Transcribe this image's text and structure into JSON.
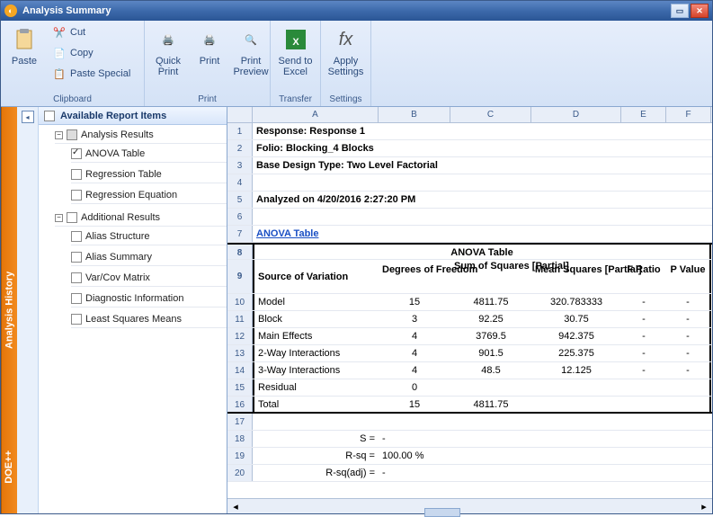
{
  "window": {
    "title": "Analysis Summary"
  },
  "ribbon": {
    "paste": "Paste",
    "cut": "Cut",
    "copy": "Copy",
    "paste_special": "Paste Special",
    "quick_print": "Quick\nPrint",
    "print": "Print",
    "print_preview": "Print\nPreview",
    "send_excel": "Send to\nExcel",
    "apply_settings": "Apply\nSettings",
    "grp_clipboard": "Clipboard",
    "grp_print": "Print",
    "grp_transfer": "Transfer",
    "grp_settings": "Settings"
  },
  "history_tab": "Analysis History",
  "branding": "DOE++",
  "tree": {
    "header": "Available Report Items",
    "root1": "Analysis Results",
    "items1": [
      "ANOVA Table",
      "Regression Table",
      "Regression Equation"
    ],
    "root2": "Additional Results",
    "items2": [
      "Alias Structure",
      "Alias Summary",
      "Var/Cov Matrix",
      "Diagnostic Information",
      "Least Squares Means"
    ]
  },
  "columns": [
    "A",
    "B",
    "C",
    "D",
    "E",
    "F"
  ],
  "meta": {
    "response": "Response: Response 1",
    "folio": "Folio: Blocking_4 Blocks",
    "design": "Base Design Type: Two Level Factorial",
    "analyzed": "Analyzed on 4/20/2016 2:27:20 PM",
    "anova_link": "ANOVA Table",
    "anova_title": "ANOVA Table"
  },
  "headers": {
    "source": "Source of Variation",
    "df": "Degrees of Freedom",
    "ss": "Sum of Squares [Partial]",
    "ms": "Mean Squares [Partial]",
    "f": "F Ratio",
    "p": "P Value"
  },
  "table": [
    {
      "src": "Model",
      "df": "15",
      "ss": "4811.75",
      "ms": "320.783333",
      "f": "-",
      "p": "-"
    },
    {
      "src": "Block",
      "df": "3",
      "ss": "92.25",
      "ms": "30.75",
      "f": "-",
      "p": "-"
    },
    {
      "src": "Main Effects",
      "df": "4",
      "ss": "3769.5",
      "ms": "942.375",
      "f": "-",
      "p": "-"
    },
    {
      "src": " 2-Way Interactions",
      "df": "4",
      "ss": "901.5",
      "ms": "225.375",
      "f": "-",
      "p": "-"
    },
    {
      "src": " 3-Way Interactions",
      "df": "4",
      "ss": "48.5",
      "ms": "12.125",
      "f": "-",
      "p": "-"
    },
    {
      "src": "Residual",
      "df": "0",
      "ss": "",
      "ms": "",
      "f": "",
      "p": ""
    },
    {
      "src": "Total",
      "df": "15",
      "ss": "4811.75",
      "ms": "",
      "f": "",
      "p": ""
    }
  ],
  "stats": {
    "s_label": "S =",
    "s_val": "-",
    "rsq_label": "R-sq =",
    "rsq_val": "100.00 %",
    "rsqa_label": "R-sq(adj) =",
    "rsqa_val": "-"
  }
}
